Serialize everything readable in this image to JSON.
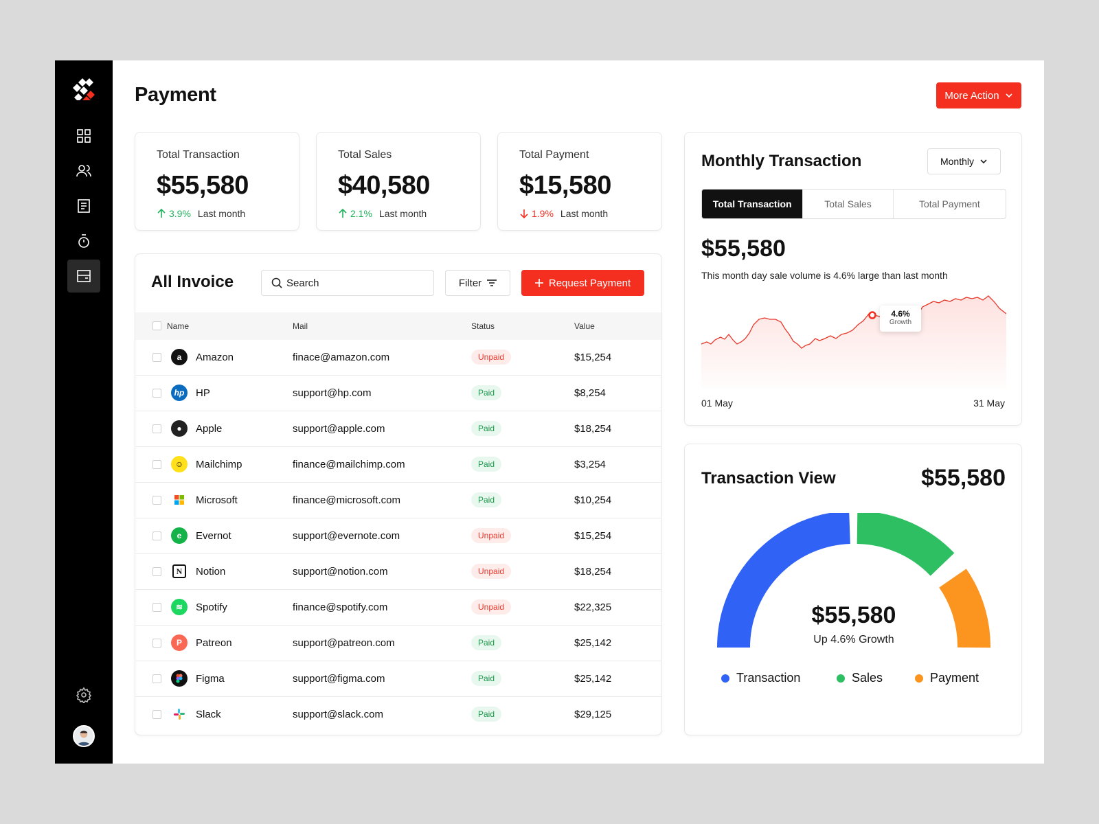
{
  "page": {
    "title": "Payment",
    "more_action": "More Action"
  },
  "stats": [
    {
      "label": "Total Transaction",
      "value": "$55,580",
      "pct": "3.9%",
      "direction": "up",
      "note": "Last month"
    },
    {
      "label": "Total Sales",
      "value": "$40,580",
      "pct": "2.1%",
      "direction": "up",
      "note": "Last month"
    },
    {
      "label": "Total Payment",
      "value": "$15,580",
      "pct": "1.9%",
      "direction": "down",
      "note": "Last month"
    }
  ],
  "invoice": {
    "title": "All Invoice",
    "search_placeholder": "Search",
    "filter_label": "Filter",
    "request_label": "Request Payment",
    "columns": {
      "name": "Name",
      "mail": "Mail",
      "status": "Status",
      "value": "Value"
    },
    "rows": [
      {
        "name": "Amazon",
        "mail": "finace@amazon.com",
        "status": "Unpaid",
        "value": "$15,254"
      },
      {
        "name": "HP",
        "mail": "support@hp.com",
        "status": "Paid",
        "value": "$8,254"
      },
      {
        "name": "Apple",
        "mail": "support@apple.com",
        "status": "Paid",
        "value": "$18,254"
      },
      {
        "name": "Mailchimp",
        "mail": "finance@mailchimp.com",
        "status": "Paid",
        "value": "$3,254"
      },
      {
        "name": "Microsoft",
        "mail": "finance@microsoft.com",
        "status": "Paid",
        "value": "$10,254"
      },
      {
        "name": "Evernot",
        "mail": "support@evernote.com",
        "status": "Unpaid",
        "value": "$15,254"
      },
      {
        "name": "Notion",
        "mail": "support@notion.com",
        "status": "Unpaid",
        "value": "$18,254"
      },
      {
        "name": "Spotify",
        "mail": "finance@spotify.com",
        "status": "Unpaid",
        "value": "$22,325"
      },
      {
        "name": "Patreon",
        "mail": "support@patreon.com",
        "status": "Paid",
        "value": "$25,142"
      },
      {
        "name": "Figma",
        "mail": "support@figma.com",
        "status": "Paid",
        "value": "$25,142"
      },
      {
        "name": "Slack",
        "mail": "support@slack.com",
        "status": "Paid",
        "value": "$29,125"
      }
    ]
  },
  "monthly": {
    "title": "Monthly Transaction",
    "period": "Monthly",
    "tabs": [
      "Total Transaction",
      "Total Sales",
      "Total Payment"
    ],
    "active_tab": 0,
    "value": "$55,580",
    "description": "This month day sale volume is 4.6% large than last month",
    "tooltip_pct": "4.6%",
    "tooltip_label": "Growth",
    "x_start": "01 May",
    "x_end": "31 May"
  },
  "transaction_view": {
    "title": "Transaction View",
    "total": "$55,580",
    "center_value": "$55,580",
    "center_sub": "Up 4.6% Growth",
    "legend": [
      {
        "name": "Transaction",
        "color": "#2f62f5"
      },
      {
        "name": "Sales",
        "color": "#2ebf62"
      },
      {
        "name": "Payment",
        "color": "#fb9520"
      }
    ]
  },
  "colors": {
    "accent": "#f42f1f",
    "up": "#1fb35a",
    "down": "#f42f1f"
  }
}
